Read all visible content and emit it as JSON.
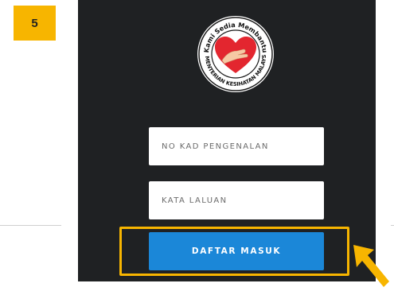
{
  "step": {
    "number": "5"
  },
  "logo": {
    "text_top": "Kami Sedia Membantu",
    "text_bottom": "KEMENTERIAN KESIHATAN MALAYSIA"
  },
  "form": {
    "ic_placeholder": "NO KAD PENGENALAN",
    "password_placeholder": "KATA LALUAN",
    "login_button": "DAFTAR MASUK"
  },
  "colors": {
    "panel": "#1f2123",
    "button": "#1b87d8",
    "highlight": "#f7b500",
    "heart": "#e3262f"
  },
  "icons": {
    "logo": "heart-hand-logo",
    "pointer": "arrow-pointer-icon"
  }
}
